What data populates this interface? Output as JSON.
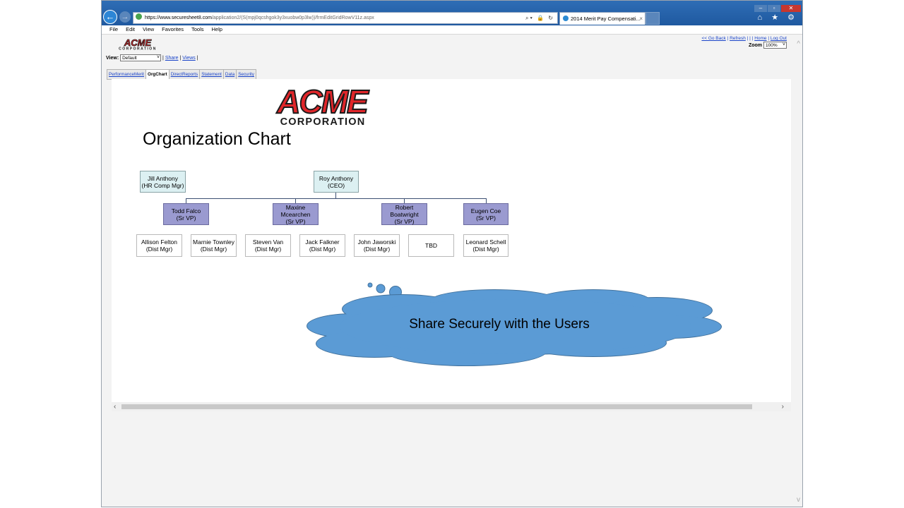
{
  "browser": {
    "url_host": "https://www.securesheet8.com",
    "url_path": "/application2/(S(mpj0qcshgok3y3xuobw0p3lw))/frmEditGridRowV11z.aspx",
    "tab_title": "2014 Merit Pay Compensati...",
    "tab_close": "×",
    "window_controls": [
      "–",
      "▫",
      "✕"
    ],
    "tool_icons": "⌂ ★ ⚙",
    "address_icons": "⌕▾ 🔒 ↻"
  },
  "menu": [
    "File",
    "Edit",
    "View",
    "Favorites",
    "Tools",
    "Help"
  ],
  "header": {
    "links": [
      "<< Go Back",
      "Refresh",
      "|",
      "|",
      "|",
      "Home",
      "Log Out"
    ],
    "zoom_label": "Zoom",
    "zoom_value": "100%"
  },
  "view": {
    "label": "View:",
    "value": "Default",
    "share": "Share",
    "views": "Views"
  },
  "tabs": [
    "PerformanceMerit",
    "OrgChart",
    "DirectReports",
    "Statement",
    "Data",
    "Security"
  ],
  "active_tab": "OrgChart",
  "logo": {
    "name": "ACME",
    "subtitle": "CORPORATION",
    "red": "#e0262a",
    "dark": "#1b1b1b"
  },
  "org_chart": {
    "title": "Organization Chart",
    "hr": {
      "name": "Jill Anthony",
      "role": "(HR Comp Mgr)"
    },
    "ceo": {
      "name": "Roy Anthony",
      "role": "(CEO)"
    },
    "vps": [
      {
        "name": "Todd Falco",
        "role": "(Sr VP)"
      },
      {
        "name": "Maxine Mcearchen",
        "role": "(Sr VP)"
      },
      {
        "name": "Robert Boatwright",
        "role": "(Sr VP)"
      },
      {
        "name": "Eugen Coe",
        "role": "(Sr VP)"
      }
    ],
    "managers": [
      {
        "name": "Allison Felton",
        "role": "(Dist Mgr)"
      },
      {
        "name": "Marnie Townley",
        "role": "(Dist Mgr)"
      },
      {
        "name": "Steven Van",
        "role": "(Dist Mgr)"
      },
      {
        "name": "Jack Falkner",
        "role": "(Dist Mgr)"
      },
      {
        "name": "John Jaworski",
        "role": "(Dist Mgr)"
      },
      {
        "name": "TBD",
        "role": ""
      },
      {
        "name": "Leonard Schell",
        "role": "(Dist Mgr)"
      }
    ]
  },
  "callout": {
    "text": "Share Securely with the Users",
    "fill": "#5b9bd5",
    "stroke": "#41719c"
  },
  "scrollbar": {
    "left": "‹",
    "right": "›",
    "up": "^",
    "down": "v"
  }
}
